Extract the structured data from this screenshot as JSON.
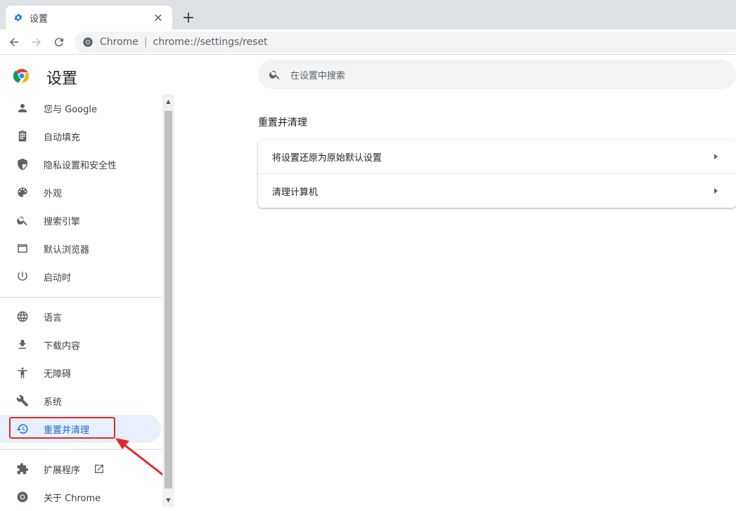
{
  "tab": {
    "title": "设置",
    "close": "✕",
    "new_tab": "+"
  },
  "toolbar": {
    "site_chip": "Chrome",
    "separator": "|",
    "url": "chrome://settings/reset"
  },
  "header": {
    "title": "设置",
    "search_placeholder": "在设置中搜索"
  },
  "sidebar": {
    "items": [
      {
        "label": "您与 Google",
        "icon": "person-icon"
      },
      {
        "label": "自动填充",
        "icon": "clipboard-icon"
      },
      {
        "label": "隐私设置和安全性",
        "icon": "shield-icon"
      },
      {
        "label": "外观",
        "icon": "palette-icon"
      },
      {
        "label": "搜索引擎",
        "icon": "search-icon"
      },
      {
        "label": "默认浏览器",
        "icon": "browser-icon"
      },
      {
        "label": "启动时",
        "icon": "power-icon"
      },
      {
        "label": "语言",
        "icon": "globe-icon"
      },
      {
        "label": "下载内容",
        "icon": "download-icon"
      },
      {
        "label": "无障碍",
        "icon": "accessibility-icon"
      },
      {
        "label": "系统",
        "icon": "wrench-icon"
      },
      {
        "label": "重置并清理",
        "icon": "restore-icon",
        "active": true
      },
      {
        "label": "扩展程序",
        "icon": "puzzle-icon"
      },
      {
        "label": "关于 Chrome",
        "icon": "chrome-icon"
      }
    ]
  },
  "main": {
    "section_title": "重置并清理",
    "rows": [
      {
        "label": "将设置还原为原始默认设置"
      },
      {
        "label": "清理计算机"
      }
    ]
  },
  "colors": {
    "accent": "#1967d2",
    "active_bg": "#e8f0fe",
    "annotation": "#e4282b"
  }
}
